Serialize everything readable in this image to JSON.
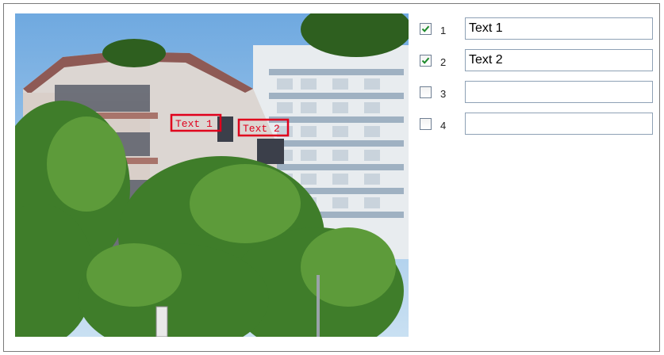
{
  "preview": {
    "overlays": [
      {
        "label": "Text 1",
        "color": "#e0001c"
      },
      {
        "label": "Text 2",
        "color": "#e0001c"
      }
    ]
  },
  "rows": [
    {
      "number": "1",
      "checked": true,
      "text": "Text 1"
    },
    {
      "number": "2",
      "checked": true,
      "text": "Text 2"
    },
    {
      "number": "3",
      "checked": false,
      "text": ""
    },
    {
      "number": "4",
      "checked": false,
      "text": ""
    }
  ],
  "colors": {
    "overlay": "#e0001c",
    "check": "#1d8a2a"
  }
}
